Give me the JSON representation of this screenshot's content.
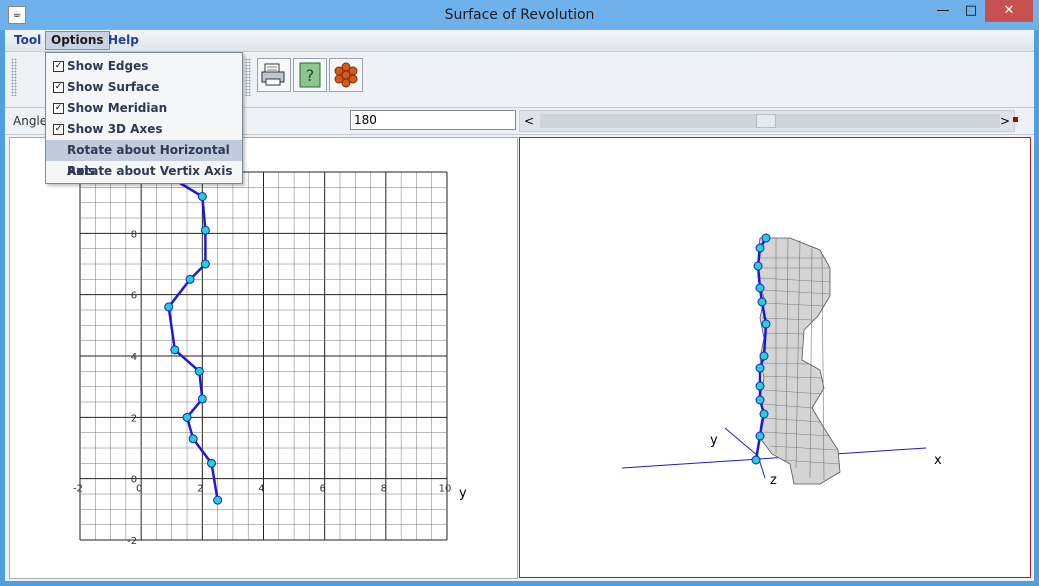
{
  "window": {
    "title": "Surface of Revolution",
    "minimize_glyph": "—",
    "maximize_glyph": "□",
    "close_glyph": "✕",
    "app_icon": "java-icon"
  },
  "menubar": {
    "tool": "Tool",
    "options": "Options",
    "help": "Help"
  },
  "options_menu": {
    "items": [
      {
        "label": "Show Edges",
        "checked": true
      },
      {
        "label": "Show Surface",
        "checked": true
      },
      {
        "label": "Show Meridian",
        "checked": true
      },
      {
        "label": "Show 3D Axes",
        "checked": true
      },
      {
        "label": "Rotate about Horizontal Axis",
        "checked": false
      },
      {
        "label": "Rotate about Vertix Axis",
        "checked": false
      }
    ]
  },
  "toolbar": {
    "buttons": [
      "print-icon",
      "help-icon",
      "flower-icon"
    ]
  },
  "angle": {
    "label": "Angle",
    "value": "180",
    "slider_left": "<",
    "slider_right": ">"
  },
  "meridian_plot": {
    "x_ticks": [
      "-2",
      "0",
      "2",
      "4",
      "6",
      "8",
      "10"
    ],
    "y_ticks": [
      "8",
      "6",
      "4",
      "2",
      "0",
      "-2"
    ],
    "axis_label_y": "y"
  },
  "view3d": {
    "axis_x": "x",
    "axis_y": "y",
    "axis_z": "z"
  },
  "colors": {
    "meridian_line": "#1a1adb",
    "meridian_point": "#22d3c8",
    "axis_line": "#1a1adb",
    "surface": "#d4d4d4",
    "selection": "#c0ccdc"
  }
}
